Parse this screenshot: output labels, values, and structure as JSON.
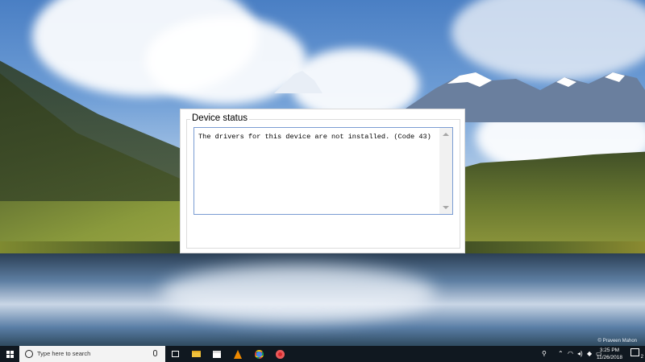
{
  "dialog": {
    "group_title": "Device status",
    "status_message": "The drivers for this device are not installed. (Code 43)"
  },
  "wallpaper": {
    "credit": "© Praveen Mahon"
  },
  "taskbar": {
    "search_placeholder": "Type here to search",
    "apps": [
      "task-view",
      "file-explorer",
      "microsoft-store",
      "vlc",
      "chrome",
      "screen-recorder"
    ],
    "tray": {
      "time": "3:25 PM",
      "date": "11/26/2018",
      "notification_count": "2"
    }
  },
  "colors": {
    "taskbar": "#101820",
    "textbox_border": "#7a9cd3",
    "dialog_bg": "#ffffff"
  }
}
